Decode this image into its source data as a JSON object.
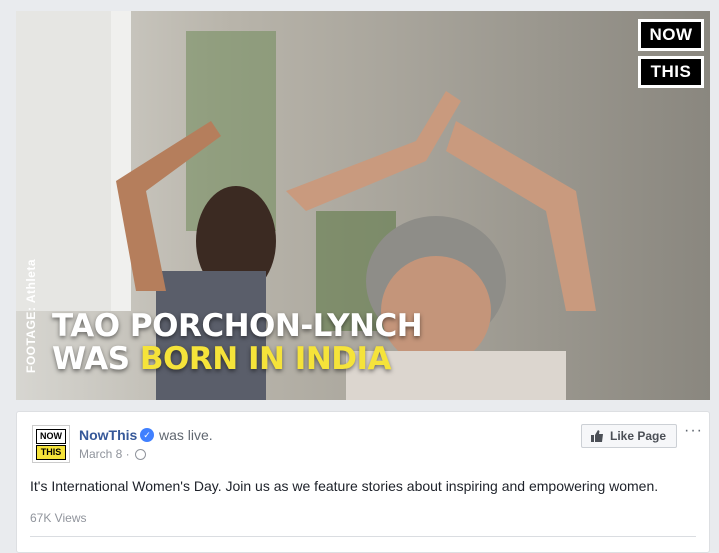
{
  "video": {
    "logo_top": "NOW",
    "logo_bottom": "THIS",
    "footage": "FOOTAGE: Athleta",
    "caption_line1": "TAO PORCHON-LYNCH",
    "caption_line2_prefix": "WAS ",
    "caption_line2_highlight": "BORN IN INDIA"
  },
  "post": {
    "avatar_top": "NOW",
    "avatar_bottom": "THIS",
    "page_name": "NowThis",
    "status": "was live.",
    "date": "March 8 ·",
    "like_button": "Like Page",
    "more": "···",
    "text": "It's International Women's Day. Join us as we feature stories about inspiring and empowering women.",
    "views": "67K Views"
  },
  "colors": {
    "link": "#365899",
    "highlight": "#f5e33a",
    "verified": "#4080ff"
  },
  "icons": [
    "verified-badge-icon",
    "globe-icon",
    "thumbs-up-icon",
    "more-icon"
  ]
}
